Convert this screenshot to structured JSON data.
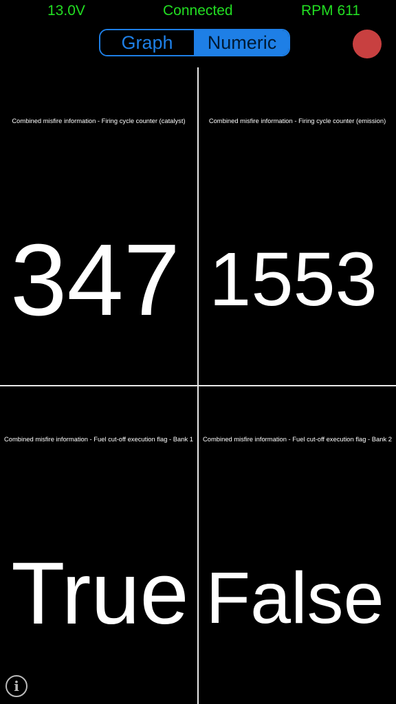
{
  "status_bar": {
    "voltage": "13.0V",
    "connection": "Connected",
    "rpm": "RPM 611",
    "color": "#22dd22"
  },
  "view_toggle": {
    "options": [
      "Graph",
      "Numeric"
    ],
    "selected": "Numeric",
    "accent_color": "#1e7fe6"
  },
  "record_button": {
    "icon": "record-icon",
    "color": "#c84040"
  },
  "cells": [
    {
      "label": "Combined misfire information  -  Firing cycle counter (catalyst)",
      "value": "347"
    },
    {
      "label": "Combined misfire information  -  Firing cycle counter (emission)",
      "value": "1553"
    },
    {
      "label": "Combined misfire information  -  Fuel cut-off execution flag  -  Bank 1",
      "value": "True"
    },
    {
      "label": "Combined misfire information  -  Fuel cut-off execution flag  -  Bank 2",
      "value": "False"
    }
  ],
  "info_button": {
    "icon": "info-icon",
    "glyph": "i"
  }
}
